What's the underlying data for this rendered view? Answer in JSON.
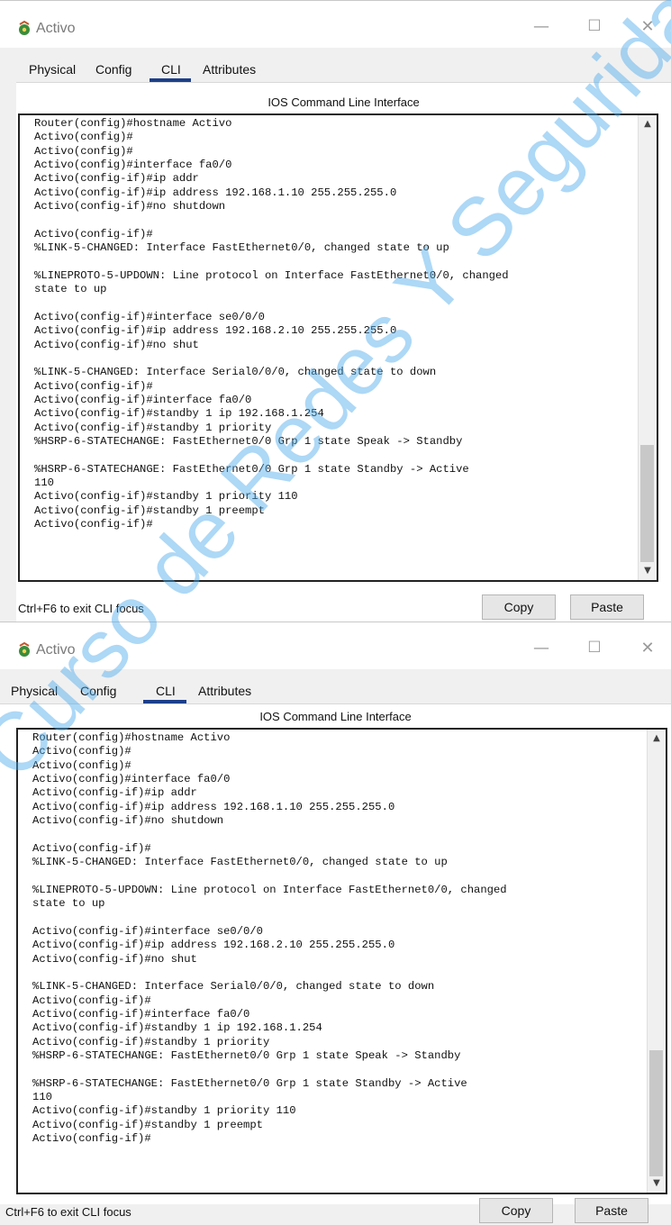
{
  "windows": [
    {
      "title": "Activo",
      "tabs": [
        "Physical",
        "Config",
        "CLI",
        "Attributes"
      ],
      "active_tab": "CLI",
      "pane_title": "IOS Command Line Interface",
      "console_text": "Router(config)#hostname Activo\nActivo(config)#\nActivo(config)#\nActivo(config)#interface fa0/0\nActivo(config-if)#ip addr\nActivo(config-if)#ip address 192.168.1.10 255.255.255.0\nActivo(config-if)#no shutdown\n\nActivo(config-if)#\n%LINK-5-CHANGED: Interface FastEthernet0/0, changed state to up\n\n%LINEPROTO-5-UPDOWN: Line protocol on Interface FastEthernet0/0, changed\nstate to up\n\nActivo(config-if)#interface se0/0/0\nActivo(config-if)#ip address 192.168.2.10 255.255.255.0\nActivo(config-if)#no shut\n\n%LINK-5-CHANGED: Interface Serial0/0/0, changed state to down\nActivo(config-if)#\nActivo(config-if)#interface fa0/0\nActivo(config-if)#standby 1 ip 192.168.1.254\nActivo(config-if)#standby 1 priority\n%HSRP-6-STATECHANGE: FastEthernet0/0 Grp 1 state Speak -> Standby\n\n%HSRP-6-STATECHANGE: FastEthernet0/0 Grp 1 state Standby -> Active\n110\nActivo(config-if)#standby 1 priority 110\nActivo(config-if)#standby 1 preempt\nActivo(config-if)#",
      "hint": "Ctrl+F6 to exit CLI focus",
      "copy_label": "Copy",
      "paste_label": "Paste"
    },
    {
      "title": "Activo",
      "tabs": [
        "Physical",
        "Config",
        "CLI",
        "Attributes"
      ],
      "active_tab": "CLI",
      "pane_title": "IOS Command Line Interface",
      "console_text": "Router(config)#hostname Activo\nActivo(config)#\nActivo(config)#\nActivo(config)#interface fa0/0\nActivo(config-if)#ip addr\nActivo(config-if)#ip address 192.168.1.10 255.255.255.0\nActivo(config-if)#no shutdown\n\nActivo(config-if)#\n%LINK-5-CHANGED: Interface FastEthernet0/0, changed state to up\n\n%LINEPROTO-5-UPDOWN: Line protocol on Interface FastEthernet0/0, changed\nstate to up\n\nActivo(config-if)#interface se0/0/0\nActivo(config-if)#ip address 192.168.2.10 255.255.255.0\nActivo(config-if)#no shut\n\n%LINK-5-CHANGED: Interface Serial0/0/0, changed state to down\nActivo(config-if)#\nActivo(config-if)#interface fa0/0\nActivo(config-if)#standby 1 ip 192.168.1.254\nActivo(config-if)#standby 1 priority\n%HSRP-6-STATECHANGE: FastEthernet0/0 Grp 1 state Speak -> Standby\n\n%HSRP-6-STATECHANGE: FastEthernet0/0 Grp 1 state Standby -> Active\n110\nActivo(config-if)#standby 1 priority 110\nActivo(config-if)#standby 1 preempt\nActivo(config-if)#",
      "hint": "Ctrl+F6 to exit CLI focus",
      "copy_label": "Copy",
      "paste_label": "Paste"
    }
  ],
  "icons": {
    "app": "packet-tracer-router-icon",
    "minimize": "minimize-icon",
    "maximize": "maximize-icon",
    "close": "close-icon",
    "scroll_up": "chevron-up-icon",
    "scroll_down": "chevron-down-icon"
  },
  "colors": {
    "active_tab_underline": "#1c3f8a",
    "watermark": "#4aa8ea",
    "console_border": "#222222"
  },
  "watermark_text": "Curso de Redes Y Seguridad"
}
